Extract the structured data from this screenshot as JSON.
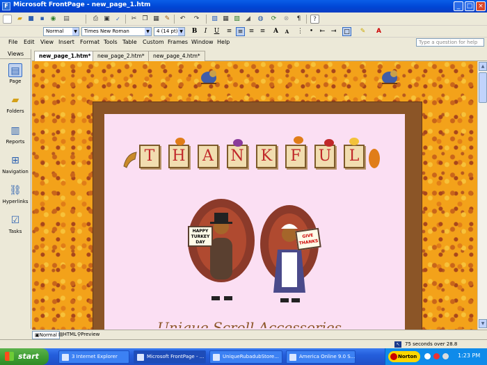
{
  "window": {
    "title": "Microsoft FrontPage - new_page_1.htm",
    "controls": [
      "minimize",
      "maximize",
      "close"
    ]
  },
  "toolbar": {
    "standard_icons": [
      "new-page-icon",
      "open-icon",
      "save-icon",
      "save-all-icon",
      "publish-icon",
      "toggle-pane-icon",
      "print-icon",
      "print-preview-icon",
      "spelling-icon",
      "cut-icon",
      "copy-icon",
      "paste-icon",
      "format-painter-icon",
      "undo-icon",
      "redo-icon",
      "web-component-icon",
      "insert-table-icon",
      "insert-picture-icon",
      "drawing-icon",
      "hyperlink-icon",
      "refresh-icon",
      "stop-icon",
      "show-all-icon",
      "help-icon"
    ],
    "style": "Normal",
    "font": "Times New Roman",
    "size": "4 (14 pt)",
    "format_buttons": [
      "B",
      "I",
      "U"
    ]
  },
  "menu": [
    "File",
    "Edit",
    "View",
    "Insert",
    "Format",
    "Tools",
    "Table",
    "Custom",
    "Frames",
    "Window",
    "Help"
  ],
  "ask_placeholder": "Type a question for help",
  "views": {
    "header": "Views",
    "items": [
      "Page",
      "Folders",
      "Reports",
      "Navigation",
      "Hyperlinks",
      "Tasks"
    ]
  },
  "tabs": [
    "new_page_1.htm*",
    "new_page_2.htm*",
    "new_page_4.htm*"
  ],
  "page": {
    "banner_letters": [
      "T",
      "H",
      "A",
      "N",
      "K",
      "F",
      "U",
      "L"
    ],
    "sign_left": "HAPPY TURKEY DAY",
    "sign_right": "GIVE THANKS",
    "script_text": "Unique Scroll Accessories"
  },
  "view_tabs": [
    "Normal",
    "HTML",
    "Preview"
  ],
  "status": "75 seconds over 28.8",
  "taskbar": {
    "start": "start",
    "tasks": [
      "3 Internet Explorer",
      "Microsoft FrontPage - ...",
      "UniqueRubadubStore...",
      "America Online 9.0 S..."
    ],
    "tray": {
      "norton": "Norton",
      "clock": "1:23 PM"
    }
  }
}
